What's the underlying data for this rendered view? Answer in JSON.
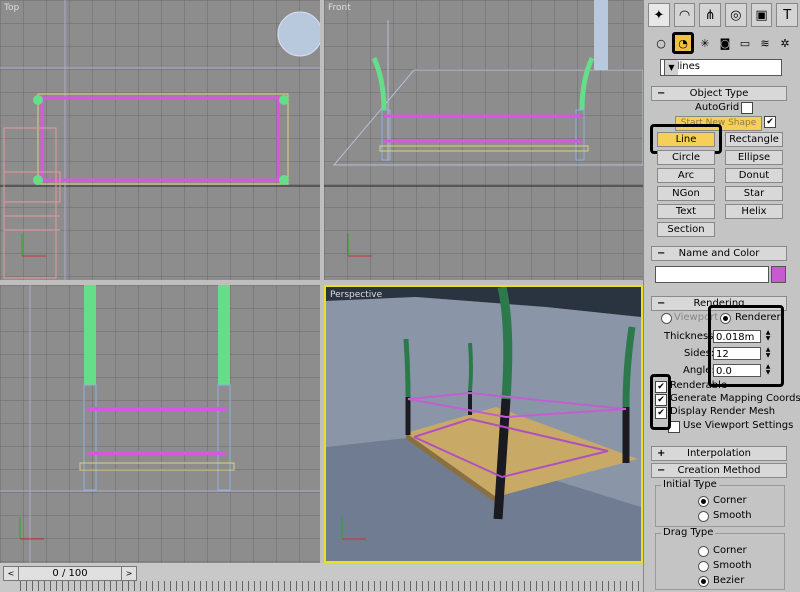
{
  "viewports": {
    "top": "Top",
    "front": "Front",
    "left": "",
    "perspective": "Perspective"
  },
  "timebar": {
    "frame_text": "0 / 100",
    "left_arrow": "<",
    "right_arrow": ">"
  },
  "panel": {
    "tabs": [
      "create-icon",
      "modify-icon",
      "hierarchy-icon",
      "motion-icon",
      "display-icon",
      "utilities-icon"
    ],
    "subtabs": [
      "geometry-icon",
      "shapes-icon",
      "lights-icon",
      "cameras-icon",
      "helpers-icon",
      "spacewarps-icon",
      "systems-icon"
    ],
    "category": "Splines",
    "object_type": {
      "title": "Object Type",
      "sign": "−",
      "autogrid": "AutoGrid",
      "start_new_shape": "Start New Shape",
      "buttons": [
        "Line",
        "Rectangle",
        "Circle",
        "Ellipse",
        "Arc",
        "Donut",
        "NGon",
        "Star",
        "Text",
        "Helix",
        "Section"
      ]
    },
    "name_color": {
      "title": "Name and Color",
      "sign": "−",
      "name": ""
    },
    "rendering": {
      "title": "Rendering",
      "sign": "−",
      "viewport": "Viewport",
      "renderer": "Renderer",
      "thickness_label": "Thickness:",
      "thickness": "0.018m",
      "sides_label": "Sides:",
      "sides": "12",
      "angle_label": "Angle:",
      "angle": "0.0",
      "renderable": "Renderable",
      "generate_mapping": "Generate Mapping Coords.",
      "display_render_mesh": "Display Render Mesh",
      "use_viewport": "Use Viewport Settings"
    },
    "interpolation": {
      "title": "Interpolation",
      "sign": "+"
    },
    "creation_method": {
      "title": "Creation Method",
      "sign": "−",
      "initial_type": "Initial Type",
      "drag_type": "Drag Type",
      "corner": "Corner",
      "smooth": "Smooth",
      "bezier": "Bezier"
    }
  },
  "colors": {
    "selected_button": "#f6cf59",
    "spline_pink": "#d657e0",
    "green_post": "#66dd88",
    "highlight": "#000000"
  }
}
